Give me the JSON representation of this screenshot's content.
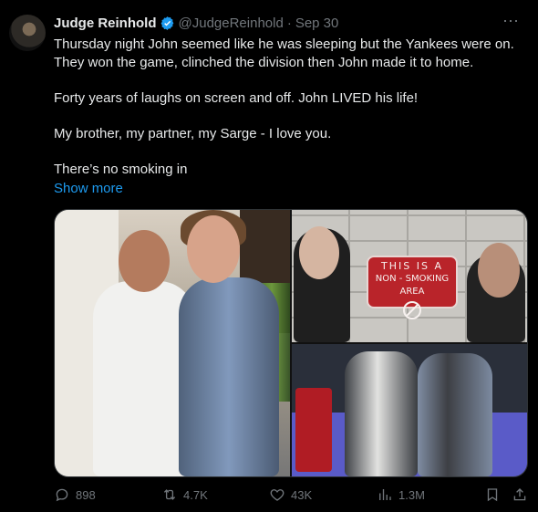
{
  "author": {
    "name": "Judge Reinhold",
    "handle": "@JudgeReinhold",
    "separator": "·",
    "date": "Sep 30"
  },
  "more_icon": "more-horizontal-icon",
  "text": {
    "p1": "Thursday night John seemed like he was sleeping but the Yankees were on. They won the game, clinched the division then John made it to home.",
    "p2": "Forty years of laughs on screen and off. John LIVED his life!",
    "p3": "My brother, my partner, my Sarge - I love you.",
    "p4": "There’s no smoking in"
  },
  "show_more": "Show more",
  "media": {
    "sign": {
      "line1": "THIS IS A",
      "line2": "NON - SMOKING AREA"
    }
  },
  "actions": {
    "replies": "898",
    "reposts": "4.7K",
    "likes": "43K",
    "views": "1.3M"
  },
  "colors": {
    "background": "#000000",
    "text": "#e7e9ea",
    "muted": "#71767b",
    "link": "#1d9bf0",
    "verified": "#1d9bf0"
  }
}
